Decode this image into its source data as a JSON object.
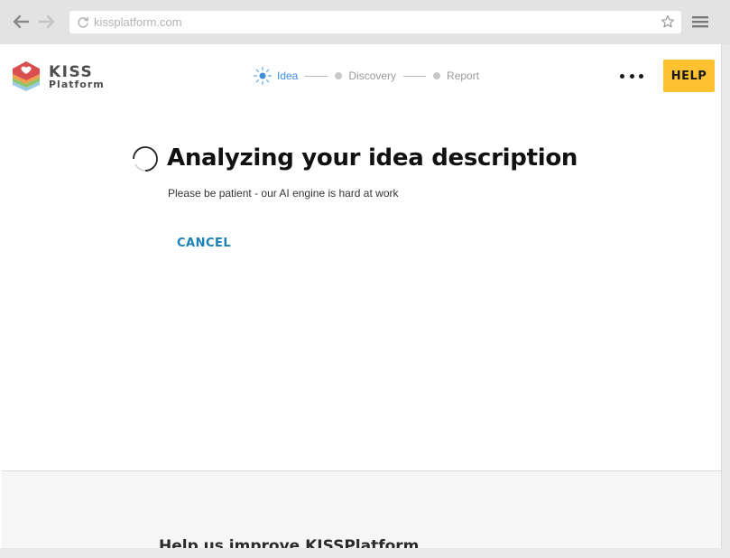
{
  "browser": {
    "url": "kissplatform.com",
    "icons": {
      "back": "arrow-left-icon",
      "forward": "arrow-right-icon",
      "reload": "reload-icon",
      "bookmark": "star-icon",
      "menu": "hamburger-icon"
    }
  },
  "header": {
    "logo": {
      "line1": "KISS",
      "line2": "Platform"
    },
    "steps": [
      {
        "label": "Idea",
        "active": true
      },
      {
        "label": "Discovery",
        "active": false
      },
      {
        "label": "Report",
        "active": false
      }
    ],
    "help_label": "HELP",
    "more_icon": "more-dots-icon"
  },
  "main": {
    "title": "Analyzing your idea description",
    "subtitle": "Please be patient - our AI engine is hard at work",
    "cancel_label": "CANCEL"
  },
  "footer": {
    "heading": "Help us improve KISSPlatform"
  },
  "colors": {
    "accent_blue": "#1b80b5",
    "step_active": "#3f8fd9",
    "help_yellow": "#fec12f",
    "logo_red": "#d94f4f",
    "logo_orange": "#f0a04b",
    "logo_green": "#8fc46b",
    "logo_lightblue": "#9ac9e3"
  }
}
